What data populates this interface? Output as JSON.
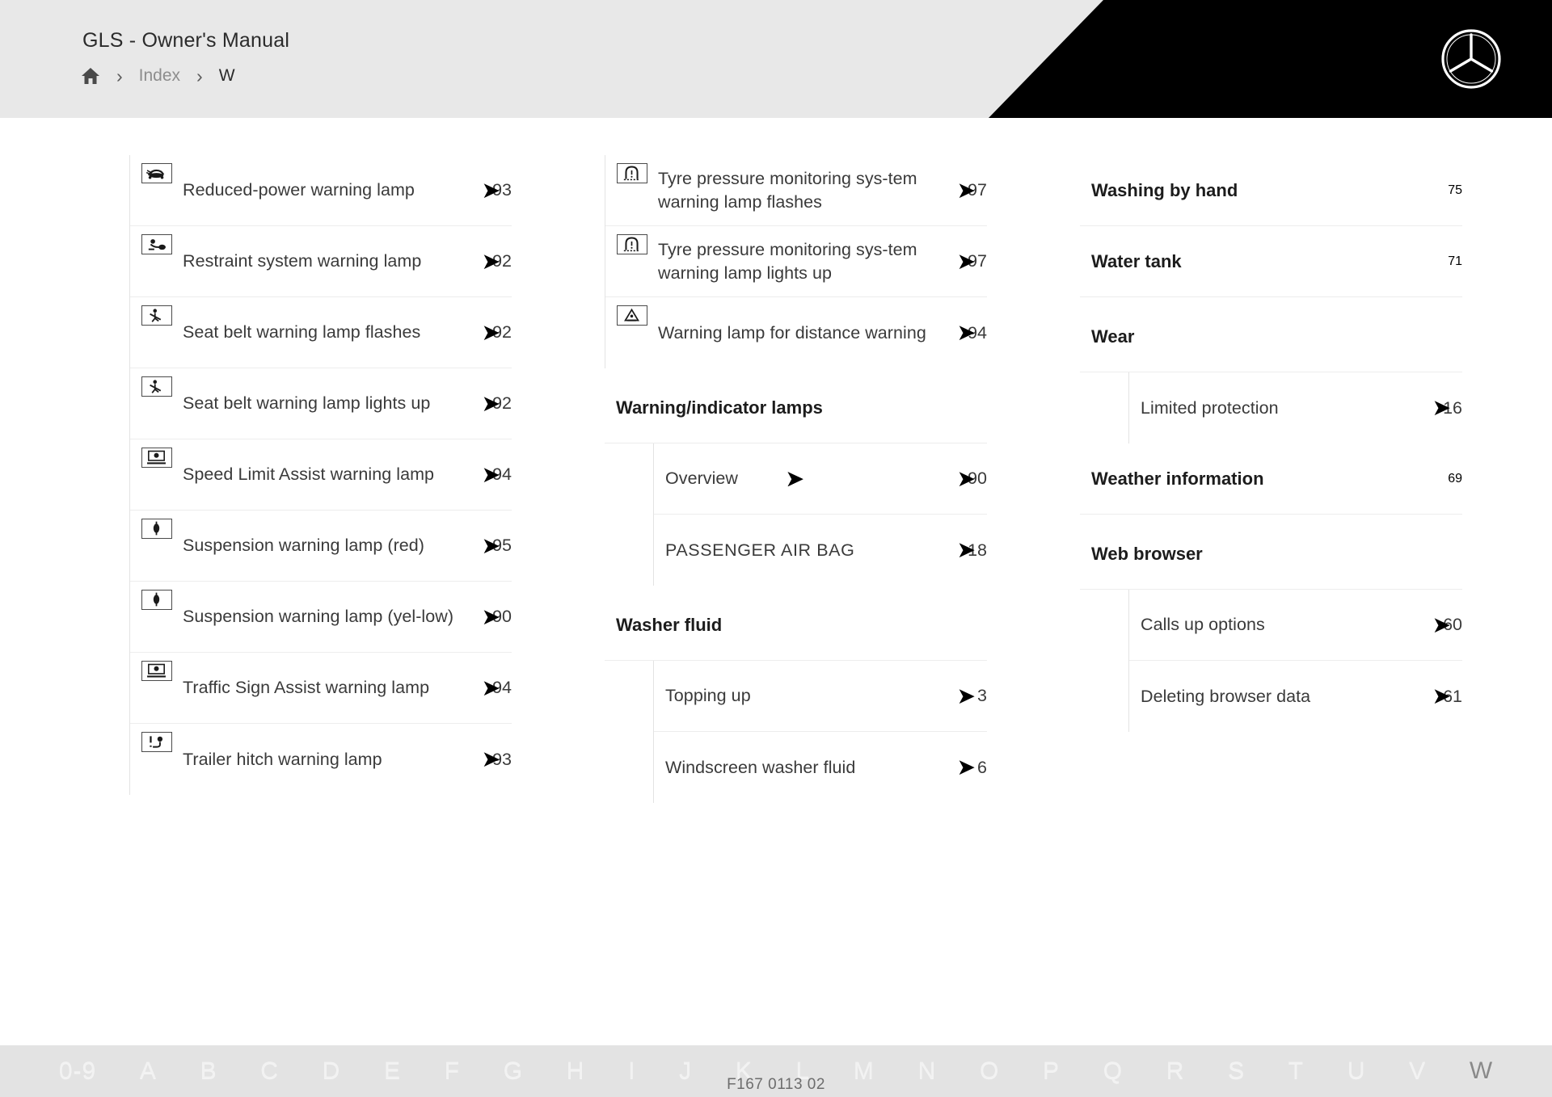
{
  "header": {
    "title": "GLS - Owner's Manual",
    "breadcrumb": {
      "home_icon": "home-icon",
      "separator": "›",
      "items": [
        "Index",
        "W"
      ]
    },
    "brand_logo": "mercedes-benz-star-logo"
  },
  "columns": [
    {
      "id": "column-1",
      "blocks": [
        {
          "type": "entry-group",
          "entries": [
            {
              "icon": "reduced-power-warning-lamp-icon",
              "label": "Reduced-power warning lamp",
              "page_prefix": "9",
              "page_suffix": "3"
            },
            {
              "icon": "restraint-system-warning-lamp-icon",
              "label": "Restraint system warning lamp",
              "page_prefix": "9",
              "page_suffix": "2"
            },
            {
              "icon": "seat-belt-warning-lamp-icon",
              "label": "Seat belt warning lamp flashes",
              "page_prefix": "9",
              "page_suffix": "2"
            },
            {
              "icon": "seat-belt-warning-lamp-icon",
              "label": "Seat belt warning lamp lights up",
              "page_prefix": "9",
              "page_suffix": "2"
            },
            {
              "icon": "speed-limit-assist-warning-lamp-icon",
              "label": "Speed Limit Assist warning lamp",
              "page_prefix": "9",
              "page_suffix": "4"
            },
            {
              "icon": "suspension-warning-lamp-icon",
              "label": "Suspension warning lamp (red)",
              "page_prefix": "9",
              "page_suffix": "5"
            },
            {
              "icon": "suspension-warning-lamp-icon",
              "label": "Suspension warning lamp (yel-low)",
              "page_prefix": "9",
              "page_suffix": "0"
            },
            {
              "icon": "traffic-sign-assist-warning-lamp-icon",
              "label": "Traffic Sign Assist warning lamp",
              "page_prefix": "9",
              "page_suffix": "4"
            },
            {
              "icon": "trailer-hitch-warning-lamp-icon",
              "label": "Trailer hitch warning lamp",
              "page_prefix": "9",
              "page_suffix": "3"
            }
          ]
        }
      ]
    },
    {
      "id": "column-2",
      "blocks": [
        {
          "type": "entry-group",
          "entries": [
            {
              "icon": "tyre-pressure-warning-lamp-icon",
              "label": "Tyre pressure monitoring sys-tem warning lamp flashes",
              "page_prefix": "9",
              "page_suffix": "7"
            },
            {
              "icon": "tyre-pressure-warning-lamp-icon",
              "label": "Tyre pressure monitoring sys-tem warning lamp lights up",
              "page_prefix": "9",
              "page_suffix": "7"
            },
            {
              "icon": "distance-warning-lamp-icon",
              "label": "Warning lamp for distance warning",
              "page_prefix": "9",
              "page_suffix": "4"
            }
          ]
        },
        {
          "type": "section",
          "heading": "Warning/indicator lamps",
          "entries": [
            {
              "label": "Overview",
              "page_prefix": "9",
              "page_suffix": "0"
            },
            {
              "label": "PASSENGER AIR BAG",
              "page_prefix": "1",
              "page_suffix": "8",
              "caps": true
            }
          ]
        },
        {
          "type": "section",
          "heading": "Washer fluid",
          "entries": [
            {
              "label": "Topping up",
              "page_prefix": "3",
              "page_suffix": ""
            },
            {
              "label": "Windscreen washer fluid",
              "page_prefix": "6",
              "page_suffix": ""
            }
          ]
        }
      ]
    },
    {
      "id": "column-3",
      "blocks": [
        {
          "type": "heading-entries",
          "entries": [
            {
              "label": "Washing by hand",
              "page_prefix": "7",
              "page_suffix": "5"
            },
            {
              "label": "Water tank",
              "page_prefix": "7",
              "page_suffix": "1"
            }
          ]
        },
        {
          "type": "section",
          "heading": "Wear",
          "entries": [
            {
              "label": "Limited protection",
              "page_prefix": "1",
              "page_suffix": "6"
            }
          ]
        },
        {
          "type": "heading-entries",
          "entries": [
            {
              "label": "Weather information",
              "page_prefix": "6",
              "page_suffix": "9"
            }
          ]
        },
        {
          "type": "section",
          "heading": "Web browser",
          "entries": [
            {
              "label": "Calls up options",
              "page_prefix": "6",
              "page_suffix": "0"
            },
            {
              "label": "Deleting browser data",
              "page_prefix": "6",
              "page_suffix": "1"
            }
          ]
        }
      ]
    }
  ],
  "alphabet_bar": {
    "letters": [
      "0-9",
      "A",
      "B",
      "C",
      "D",
      "E",
      "F",
      "G",
      "H",
      "I",
      "J",
      "K",
      "L",
      "M",
      "N",
      "O",
      "P",
      "Q",
      "R",
      "S",
      "T",
      "U",
      "V",
      "W"
    ],
    "active": "W"
  },
  "footer": {
    "document_code": "F167 0113 02"
  }
}
